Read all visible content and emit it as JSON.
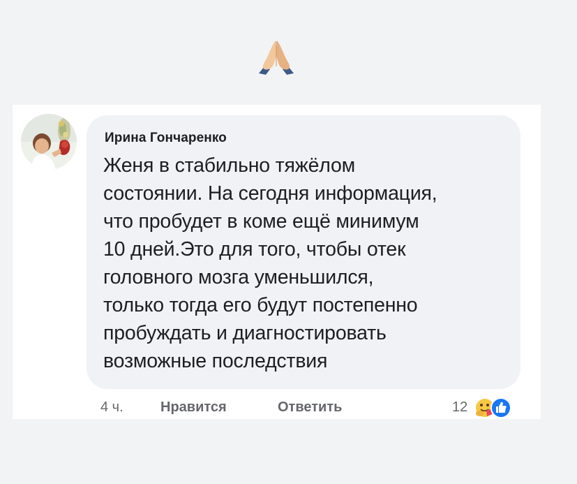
{
  "top_emoji": "folded-hands-icon",
  "comment": {
    "author": "Ирина Гончаренко",
    "text_lines": [
      "Женя в стабильно тяжёлом",
      "состоянии. На сегодня информация,",
      "что пробудет в коме ещё минимум",
      "10 дней.Это для того, чтобы отек",
      "головного мозга уменьшился,",
      "только тогда его будут постепенно",
      "пробуждать и диагностировать",
      "возможные последствия"
    ],
    "time": "4 ч.",
    "like_label": "Нравится",
    "reply_label": "Ответить",
    "reaction_count": "12",
    "reactions": [
      "care-reaction-icon",
      "like-reaction-icon"
    ]
  },
  "colors": {
    "page_bg": "#f2f3f5",
    "bubble_bg": "#f0f2f5",
    "text": "#1c1e21",
    "secondary_text": "#65676b",
    "like_blue": "#1877f2"
  }
}
